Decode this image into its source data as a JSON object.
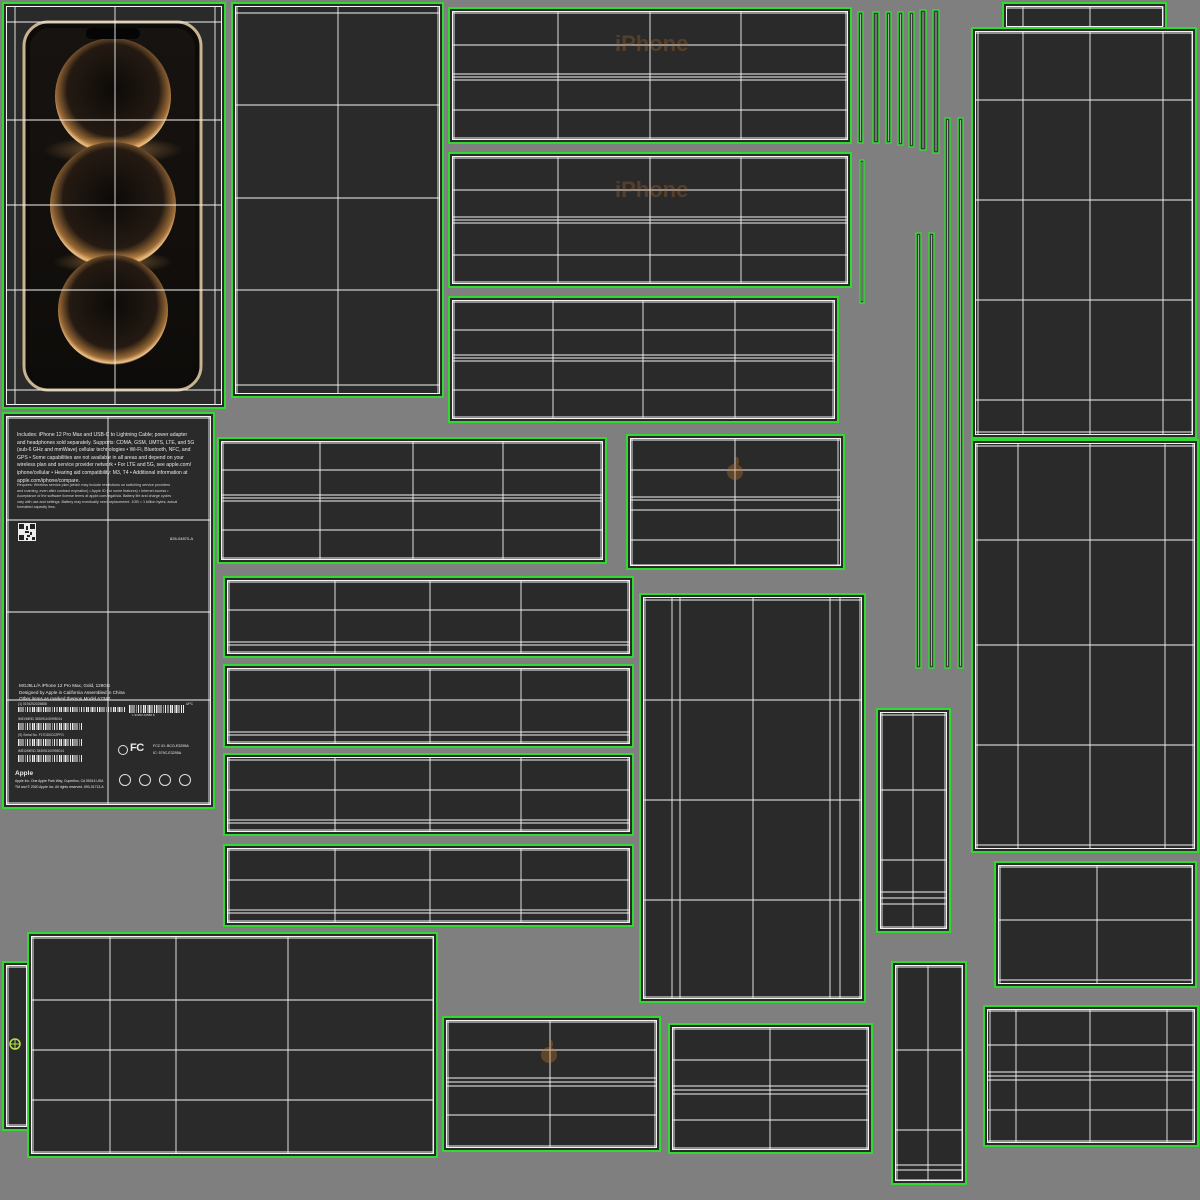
{
  "colors": {
    "background": "#7f7f7f",
    "panel": "#2a2a2a",
    "outline": "#33d933",
    "wire": "#f4f4f4",
    "strip": "#3b3b3b",
    "gold": "#d6a35e",
    "phone_frame": "#c9b48f"
  },
  "watermarks": [
    "iPhone",
    "iPhone"
  ],
  "box_back_label": {
    "includes_lines": [
      "Includes: iPhone 12 Pro Max and USB-C to Lightning Cable; power adapter",
      "and headphones sold separately. Supports: CDMA, GSM, UMTS, LTE, and 5G",
      "(sub-6 GHz and mmWave) cellular technologies • Wi-Fi, Bluetooth, NFC, and",
      "GPS • Some capabilities are not available in all areas and depend on your",
      "wireless plan and service provider network • For LTE and 5G, see apple.com/",
      "iphone/cellular • Hearing aid compatibility: M3, T4 • Additional information at",
      "apple.com/iphone/compare."
    ],
    "requires_lines": [
      "Requires: Wireless service plan (which may include restrictions on switching service providers",
      "and roaming, even after contract expiration) • Apple ID (for some features) • Internet access •",
      "Acceptance of the software license terms at apple.com/legal/sla. Battery life and charge cycles",
      "vary with use and settings. Battery may eventually need replacement. 1GB = 1 billion bytes; actual",
      "formatted capacity less."
    ],
    "part_number": "826-04870-A",
    "product_lines": [
      "MGJ5LL/A iPhone 12 Pro Max, Gold, 128GB",
      "Designed by Apple in California Assembled in China",
      "Other items as marked thereon Model A2342"
    ],
    "barcode_labels": [
      "(1) 0194252025888",
      "IMEI/MEID 353091100995014",
      "(S) Serial No. F17DD0C02PFG",
      "IMEI2/MEID 353091100995014"
    ],
    "upc_label": "UPC",
    "upc_number": "1 94252 02588 8",
    "fcc_logo": "FC",
    "fcc_id": "FCC ID: BCG-E3295A",
    "ic_id": "IC: 579C-E3295A",
    "brand": "Apple",
    "address": "Apple Inc. One Apple Park Way, Cupertino, CA 95014 USA",
    "copyright": "TM and © 2020 Apple Inc. All rights reserved. 690-01713-A"
  },
  "icons": [
    "apple-logo-icon",
    "pivot-marker-icon",
    "qr-code",
    "circle-mark-icon",
    "weee-bin-icon",
    "ce-mark-icon",
    "recycle-icon",
    "battery-recycle-icon"
  ]
}
